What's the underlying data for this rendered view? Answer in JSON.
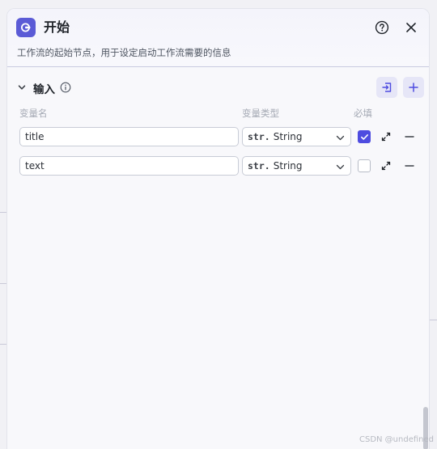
{
  "panel": {
    "title": "开始",
    "description": "工作流的起始节点，用于设定启动工作流需要的信息"
  },
  "section": {
    "title": "输入"
  },
  "columns": {
    "name": "变量名",
    "type": "变量类型",
    "required": "必填"
  },
  "variables": [
    {
      "name": "title",
      "type_prefix": "str.",
      "type_label": "String",
      "required": true
    },
    {
      "name": "text",
      "type_prefix": "str.",
      "type_label": "String",
      "required": false
    }
  ],
  "watermark": "CSDN @undefined",
  "colors": {
    "accent": "#5b5bd6",
    "checkbox_on": "#4e4ce0",
    "icon_button_bg": "#e6e6f7"
  },
  "icons": {
    "node": "start-node-icon",
    "help": "help-circle-icon",
    "close": "close-icon",
    "collapse": "chevron-down-icon",
    "info": "info-icon",
    "import": "import-icon",
    "add": "plus-icon",
    "expand": "expand-arrows-icon",
    "remove": "minus-icon"
  }
}
